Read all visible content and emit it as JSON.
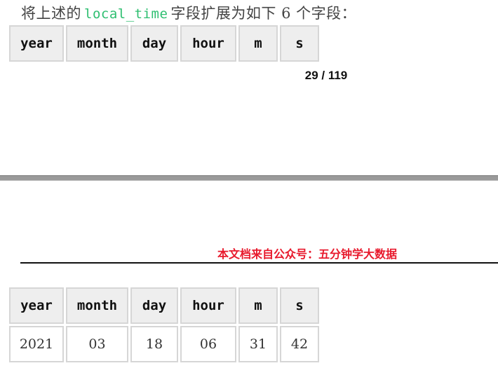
{
  "intro": {
    "prefix": "将上述的",
    "code": "local_time",
    "suffix": "字段扩展为如下 6 个字段："
  },
  "table_headers": [
    "year",
    "month",
    "day",
    "hour",
    "m",
    "s"
  ],
  "page_number": "29 / 119",
  "watermark": "本文档来自公众号：五分钟学大数据",
  "example_table": {
    "headers": [
      "year",
      "month",
      "day",
      "hour",
      "m",
      "s"
    ],
    "rows": [
      [
        "2021",
        "03",
        "18",
        "06",
        "31",
        "42"
      ]
    ]
  }
}
